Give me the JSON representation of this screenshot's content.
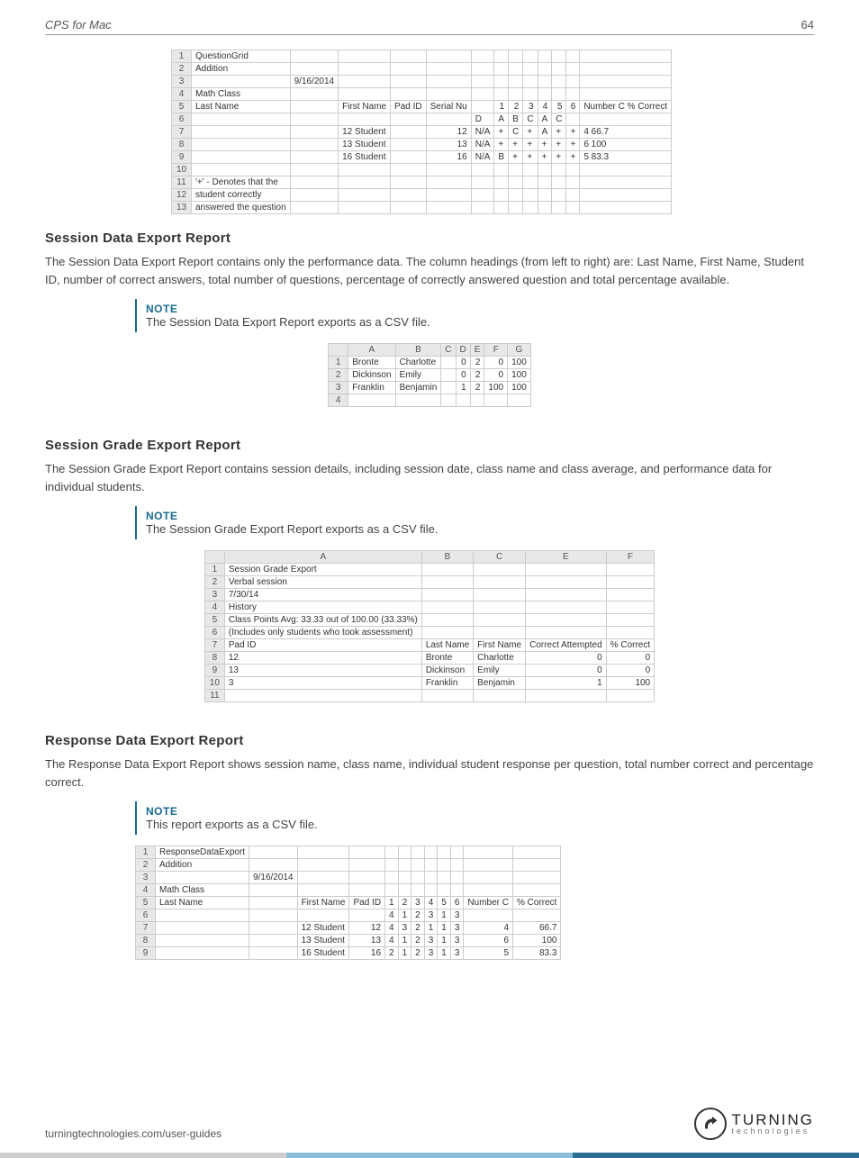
{
  "header": {
    "title": "CPS for Mac",
    "page_no": "64"
  },
  "questionGrid": {
    "rows": [
      [
        "1",
        "QuestionGrid",
        "",
        "",
        "",
        "",
        "",
        "",
        "",
        "",
        "",
        "",
        "",
        ""
      ],
      [
        "2",
        "Addition",
        "",
        "",
        "",
        "",
        "",
        "",
        "",
        "",
        "",
        "",
        "",
        ""
      ],
      [
        "3",
        "",
        "9/16/2014",
        "",
        "",
        "",
        "",
        "",
        "",
        "",
        "",
        "",
        "",
        ""
      ],
      [
        "4",
        "Math Class",
        "",
        "",
        "",
        "",
        "",
        "",
        "",
        "",
        "",
        "",
        "",
        ""
      ],
      [
        "5",
        "Last Name",
        "",
        "First Name",
        "Pad ID",
        "Serial Nu",
        "",
        "1",
        "2",
        "3",
        "4",
        "5",
        "6",
        "Number C % Correct"
      ],
      [
        "6",
        "",
        "",
        "",
        "",
        "",
        "D",
        "A",
        "B",
        "C",
        "A",
        "C",
        "",
        ""
      ],
      [
        "7",
        "",
        "",
        "12 Student",
        "",
        "12",
        "N/A",
        "+",
        "C",
        "+",
        "A",
        "+",
        "+",
        "4    66.7"
      ],
      [
        "8",
        "",
        "",
        "13 Student",
        "",
        "13",
        "N/A",
        "+",
        "+",
        "+",
        "+",
        "+",
        "+",
        "6    100"
      ],
      [
        "9",
        "",
        "",
        "16 Student",
        "",
        "16",
        "N/A",
        "B",
        "+",
        "+",
        "+",
        "+",
        "+",
        "5    83.3"
      ],
      [
        "10",
        "",
        "",
        "",
        "",
        "",
        "",
        "",
        "",
        "",
        "",
        "",
        "",
        ""
      ],
      [
        "11",
        "'+' - Denotes that the",
        "",
        "",
        "",
        "",
        "",
        "",
        "",
        "",
        "",
        "",
        "",
        ""
      ],
      [
        "12",
        "student correctly",
        "",
        "",
        "",
        "",
        "",
        "",
        "",
        "",
        "",
        "",
        "",
        ""
      ],
      [
        "13",
        "answered the question",
        "",
        "",
        "",
        "",
        "",
        "",
        "",
        "",
        "",
        "",
        "",
        ""
      ]
    ]
  },
  "sections": {
    "sde": {
      "title": "Session Data Export Report",
      "para": "The Session Data Export Report contains only the performance data. The column headings (from left to right) are: Last Name, First Name, Student ID, number of correct answers, total number of questions, percentage of correctly answered question and total percentage available.",
      "note_label": "NOTE",
      "note_text": "The Session Data Export Report exports as a CSV file.",
      "table": {
        "headers": [
          "",
          "A",
          "B",
          "C",
          "D",
          "E",
          "F",
          "G"
        ],
        "rows": [
          [
            "1",
            "Bronte",
            "Charlotte",
            "",
            "0",
            "2",
            "0",
            "100"
          ],
          [
            "2",
            "Dickinson",
            "Emily",
            "",
            "0",
            "2",
            "0",
            "100"
          ],
          [
            "3",
            "Franklin",
            "Benjamin",
            "",
            "1",
            "2",
            "100",
            "100"
          ],
          [
            "4",
            "",
            "",
            "",
            "",
            "",
            "",
            ""
          ]
        ]
      }
    },
    "sge": {
      "title": "Session Grade Export Report",
      "para": "The Session Grade Export Report contains session details, including session date, class name and class average, and performance data for individual students.",
      "note_label": "NOTE",
      "note_text": "The Session Grade Export Report exports as a CSV file.",
      "table": {
        "headers": [
          "",
          "A",
          "B",
          "C",
          "E",
          "F"
        ],
        "rows": [
          [
            "1",
            "Session Grade Export",
            "",
            "",
            "",
            ""
          ],
          [
            "2",
            "Verbal session",
            "",
            "",
            "",
            ""
          ],
          [
            "3",
            "7/30/14",
            "",
            "",
            "",
            ""
          ],
          [
            "4",
            "History",
            "",
            "",
            "",
            ""
          ],
          [
            "5",
            "Class Points Avg: 33.33 out of 100.00 (33.33%)",
            "",
            "",
            "",
            ""
          ],
          [
            "6",
            "(Includes only students who took assessment)",
            "",
            "",
            "",
            ""
          ],
          [
            "7",
            "Pad ID",
            "Last Name",
            "First Name",
            "Correct Attempted",
            "% Correct"
          ],
          [
            "8",
            "12",
            "Bronte",
            "Charlotte",
            "0",
            "0"
          ],
          [
            "9",
            "13",
            "Dickinson",
            "Emily",
            "0",
            "0"
          ],
          [
            "10",
            "3",
            "Franklin",
            "Benjamin",
            "1",
            "100"
          ],
          [
            "11",
            "",
            "",
            "",
            "",
            ""
          ]
        ]
      }
    },
    "rde": {
      "title": "Response Data Export Report",
      "para": "The Response Data Export Report shows session name, class name, individual student response per question, total number correct and percentage correct.",
      "note_label": "NOTE",
      "note_text": "This report exports as a CSV file.",
      "table": {
        "rows": [
          [
            "1",
            "ResponseDataExport",
            "",
            "",
            "",
            "",
            "",
            "",
            "",
            "",
            "",
            "",
            ""
          ],
          [
            "2",
            "Addition",
            "",
            "",
            "",
            "",
            "",
            "",
            "",
            "",
            "",
            "",
            ""
          ],
          [
            "3",
            "",
            "9/16/2014",
            "",
            "",
            "",
            "",
            "",
            "",
            "",
            "",
            "",
            ""
          ],
          [
            "4",
            "Math Class",
            "",
            "",
            "",
            "",
            "",
            "",
            "",
            "",
            "",
            "",
            ""
          ],
          [
            "5",
            "Last Name",
            "",
            "First Name",
            "Pad ID",
            "1",
            "2",
            "3",
            "4",
            "5",
            "6",
            "Number C",
            "% Correct"
          ],
          [
            "6",
            "",
            "",
            "",
            "",
            "4",
            "1",
            "2",
            "3",
            "1",
            "3",
            "",
            ""
          ],
          [
            "7",
            "",
            "",
            "12 Student",
            "12",
            "4",
            "3",
            "2",
            "1",
            "1",
            "3",
            "4",
            "66.7"
          ],
          [
            "8",
            "",
            "",
            "13 Student",
            "13",
            "4",
            "1",
            "2",
            "3",
            "1",
            "3",
            "6",
            "100"
          ],
          [
            "9",
            "",
            "",
            "16 Student",
            "16",
            "2",
            "1",
            "2",
            "3",
            "1",
            "3",
            "5",
            "83.3"
          ]
        ]
      }
    }
  },
  "footer": {
    "url": "turningtechnologies.com/user-guides",
    "brand_big": "TURNING",
    "brand_small": "technologies"
  }
}
